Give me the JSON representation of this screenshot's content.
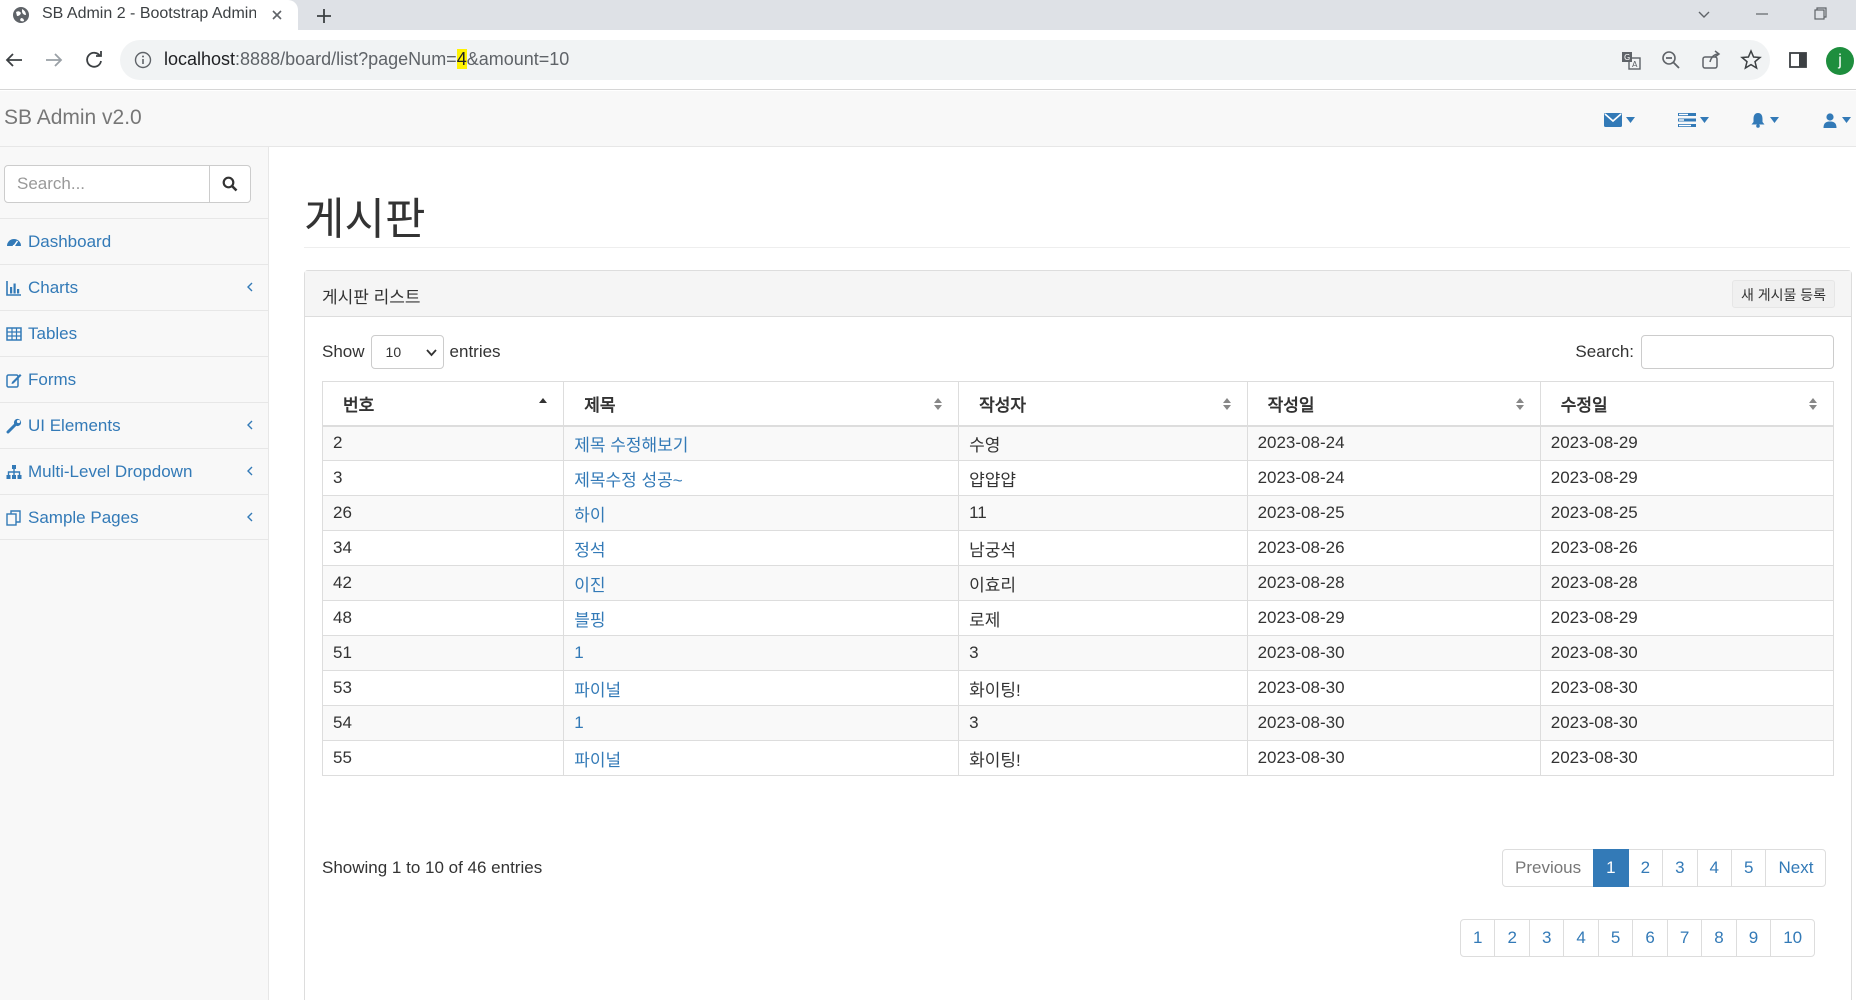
{
  "browser": {
    "tab_title": "SB Admin 2 - Bootstrap Admin",
    "url_host": "localhost",
    "url_rest_a": ":8888/board/list?pageNum=",
    "url_highlight": "4",
    "url_rest_b": "&amount=10",
    "profile_initial": "j"
  },
  "navbar": {
    "brand": "SB Admin v2.0",
    "icons": [
      "envelope-icon",
      "tasks-icon",
      "bell-icon",
      "user-icon"
    ]
  },
  "sidebar": {
    "search_placeholder": "Search...",
    "items": [
      {
        "label": "Dashboard",
        "icon": "dashboard-icon",
        "has_arrow": false
      },
      {
        "label": "Charts",
        "icon": "bar-chart-icon",
        "has_arrow": true
      },
      {
        "label": "Tables",
        "icon": "table-icon",
        "has_arrow": false
      },
      {
        "label": "Forms",
        "icon": "edit-icon",
        "has_arrow": false
      },
      {
        "label": "UI Elements",
        "icon": "wrench-icon",
        "has_arrow": true
      },
      {
        "label": "Multi-Level Dropdown",
        "icon": "sitemap-icon",
        "has_arrow": true
      },
      {
        "label": "Sample Pages",
        "icon": "files-icon",
        "has_arrow": true
      }
    ]
  },
  "main": {
    "page_title": "게시판",
    "panel_title": "게시판 리스트",
    "new_post_button": "새 게시물 등록",
    "show_label": "Show",
    "show_value": "10",
    "entries_label": "entries",
    "search_label": "Search:",
    "columns": [
      "번호",
      "제목",
      "작성자",
      "작성일",
      "수정일"
    ],
    "rows": [
      {
        "no": "2",
        "title": "제목 수정해보기",
        "writer": "수영",
        "regdate": "2023-08-24",
        "updatedate": "2023-08-29"
      },
      {
        "no": "3",
        "title": "제목수정 성공~",
        "writer": "얍얍얍",
        "regdate": "2023-08-24",
        "updatedate": "2023-08-29"
      },
      {
        "no": "26",
        "title": "하이",
        "writer": "11",
        "regdate": "2023-08-25",
        "updatedate": "2023-08-25"
      },
      {
        "no": "34",
        "title": "정석",
        "writer": "남궁석",
        "regdate": "2023-08-26",
        "updatedate": "2023-08-26"
      },
      {
        "no": "42",
        "title": "이진",
        "writer": "이효리",
        "regdate": "2023-08-28",
        "updatedate": "2023-08-28"
      },
      {
        "no": "48",
        "title": "블핑",
        "writer": "로제",
        "regdate": "2023-08-29",
        "updatedate": "2023-08-29"
      },
      {
        "no": "51",
        "title": "1",
        "writer": "3",
        "regdate": "2023-08-30",
        "updatedate": "2023-08-30"
      },
      {
        "no": "53",
        "title": "파이널",
        "writer": "화이팅!",
        "regdate": "2023-08-30",
        "updatedate": "2023-08-30"
      },
      {
        "no": "54",
        "title": "1",
        "writer": "3",
        "regdate": "2023-08-30",
        "updatedate": "2023-08-30"
      },
      {
        "no": "55",
        "title": "파이널",
        "writer": "화이팅!",
        "regdate": "2023-08-30",
        "updatedate": "2023-08-30"
      }
    ],
    "info": "Showing 1 to 10 of 46 entries",
    "dt_pager": {
      "prev": "Previous",
      "pages": [
        "1",
        "2",
        "3",
        "4",
        "5"
      ],
      "active": "1",
      "next": "Next"
    },
    "num_pager": [
      "1",
      "2",
      "3",
      "4",
      "5",
      "6",
      "7",
      "8",
      "9",
      "10"
    ]
  },
  "colors": {
    "link": "#337ab7",
    "active_page": "#337ab7",
    "url_highlight": "#fff200"
  }
}
